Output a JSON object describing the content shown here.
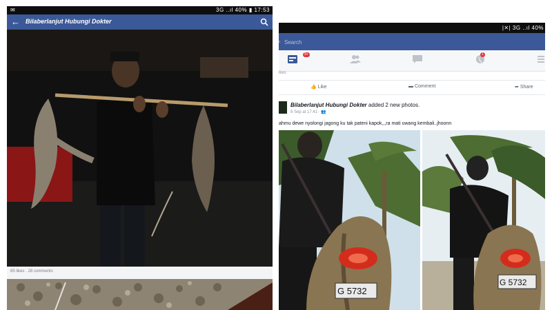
{
  "left": {
    "status": {
      "right_text": "3G ..ıl 40% ▮ 17:53"
    },
    "appbar": {
      "title": "Bilaberlanjut Hubungi Dokter"
    },
    "caption": "65 likes · 28 comments"
  },
  "right": {
    "status": {
      "right_text": "|✕| 3G ..ıl 40%"
    },
    "search": {
      "placeholder": "Search"
    },
    "tabs": [
      {
        "name": "news-feed",
        "icon": "news-feed-icon",
        "badge": "9+"
      },
      {
        "name": "friend-requests",
        "icon": "friends-icon",
        "badge": ""
      },
      {
        "name": "messages",
        "icon": "messages-icon",
        "badge": ""
      },
      {
        "name": "notifications",
        "icon": "globe-icon",
        "badge": "1"
      },
      {
        "name": "more",
        "icon": "menu-icon",
        "badge": ""
      }
    ],
    "likes_text": "ikes",
    "actions": {
      "like": "Like",
      "comment": "Comment",
      "share": "Share"
    },
    "post": {
      "author": "Bilaberlanjut Hubungi Dokter",
      "action_text": "added 2 new photos.",
      "meta": "8 Sep at 17:41 · 👥",
      "text": "ahmu dewe nyolongi jagong ku tak pateni kapok,,,ra mati uwang kembali..jhoonn",
      "plate_left": "G 5732",
      "plate_right": "G 5732"
    }
  },
  "colors": {
    "facebook_blue": "#3b5998",
    "badge_red": "#e0393e"
  }
}
